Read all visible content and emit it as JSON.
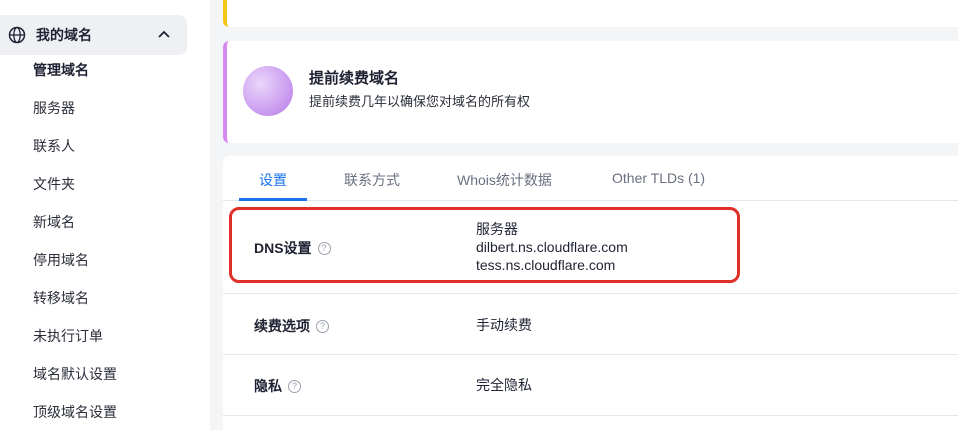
{
  "sidebar": {
    "group_label": "我的域名",
    "items": [
      {
        "label": "管理域名"
      },
      {
        "label": "服务器"
      },
      {
        "label": "联系人"
      },
      {
        "label": "文件夹"
      },
      {
        "label": "新域名"
      },
      {
        "label": "停用域名"
      },
      {
        "label": "转移域名"
      },
      {
        "label": "未执行订单"
      },
      {
        "label": "域名默认设置"
      },
      {
        "label": "顶级域名设置"
      }
    ]
  },
  "promo": {
    "title": "提前续费域名",
    "subtitle": "提前续费几年以确保您对域名的所有权"
  },
  "tabs": [
    {
      "label": "设置"
    },
    {
      "label": "联系方式"
    },
    {
      "label": "Whois统计数据"
    },
    {
      "label": "Other TLDs (1)"
    }
  ],
  "settings": {
    "dns": {
      "label": "DNS设置",
      "heading": "服务器",
      "servers": [
        "dilbert.ns.cloudflare.com",
        "tess.ns.cloudflare.com"
      ]
    },
    "renewal": {
      "label": "续费选项",
      "value": "手动续费"
    },
    "privacy": {
      "label": "隐私",
      "value": "完全隐私"
    }
  },
  "colors": {
    "accent": "#1a73e8",
    "highlight": "#e0302a",
    "promo_border": "#d58cf2",
    "top_card_border": "#f5c518"
  },
  "icons": {
    "group": "globe-icon",
    "collapse": "chevron-up-icon",
    "help": "help-circle-icon"
  }
}
